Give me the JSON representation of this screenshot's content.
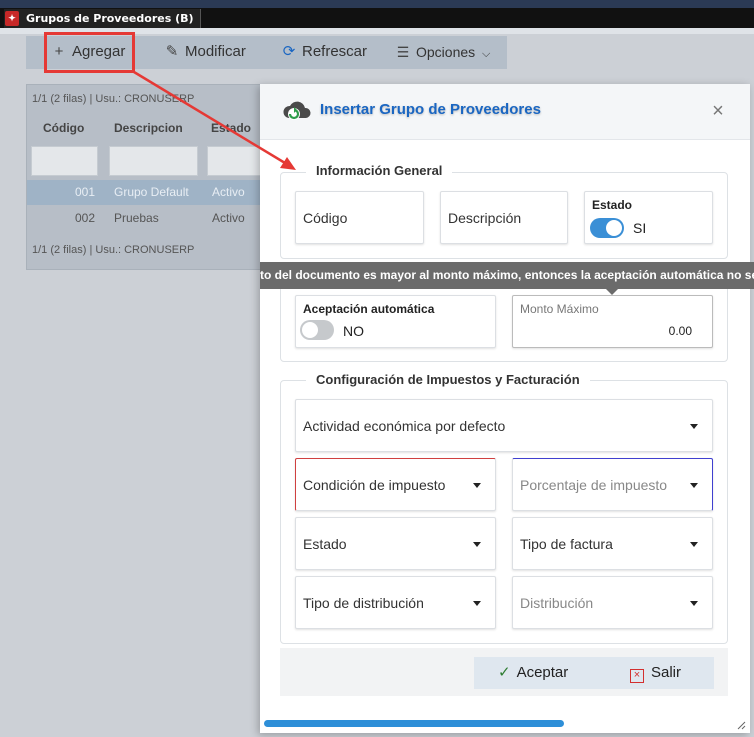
{
  "window": {
    "tab_title": "Grupos de Proveedores (B)"
  },
  "toolbar": {
    "add_label": "Agregar",
    "edit_label": "Modificar",
    "refresh_label": "Refrescar",
    "options_label": "Opciones"
  },
  "grid": {
    "info_top": "1/1 (2 filas) | Usu.: CRONUSERP",
    "info_bottom": "1/1 (2 filas) | Usu.: CRONUSERP",
    "columns": [
      "Código",
      "Descripcion",
      "Estado"
    ],
    "rows": [
      {
        "code": "001",
        "desc": "Grupo Default",
        "status": "Activo"
      },
      {
        "code": "002",
        "desc": "Pruebas",
        "status": "Activo"
      }
    ]
  },
  "modal": {
    "title": "Insertar Grupo de Proveedores",
    "general_legend": "Información General",
    "code_label": "Código",
    "description_label": "Descripción",
    "status_label": "Estado",
    "status_value": "SI",
    "status_on": true,
    "tooltip": "to del documento es mayor al monto máximo, entonces la aceptación automática no se",
    "auto_accept_label": "Aceptación automática",
    "auto_accept_value": "NO",
    "auto_accept_on": false,
    "max_amount_label": "Monto Máximo",
    "max_amount_value": "0.00",
    "tax_legend": "Configuración de Impuestos y Facturación",
    "economic_activity_label": "Actividad económica por defecto",
    "tax_condition_label": "Condición de impuesto",
    "tax_percentage_label": "Porcentaje de impuesto",
    "state_label": "Estado",
    "invoice_type_label": "Tipo de factura",
    "distribution_type_label": "Tipo de distribución",
    "distribution_label": "Distribución",
    "accept_label": "Aceptar",
    "exit_label": "Salir"
  },
  "colors": {
    "accent": "#1a66c2",
    "toggle_on": "#3a8fd6",
    "highlight_red": "#e53935",
    "progress": "#2e8fd8"
  }
}
